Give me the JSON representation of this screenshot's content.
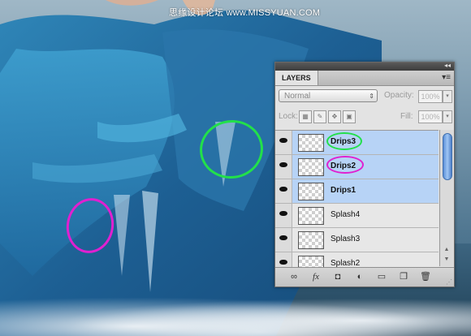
{
  "watermark": "思缘设计论坛 www.MISSYUAN.COM",
  "panel": {
    "tab": "LAYERS",
    "blend_mode": "Normal",
    "opacity_label": "Opacity:",
    "opacity_value": "100%",
    "lock_label": "Lock:",
    "fill_label": "Fill:",
    "fill_value": "100%",
    "layers": [
      {
        "name": "Drips3",
        "selected": true
      },
      {
        "name": "Drips2",
        "selected": true
      },
      {
        "name": "Drips1",
        "selected": true
      },
      {
        "name": "Splash4",
        "selected": false
      },
      {
        "name": "Splash3",
        "selected": false
      },
      {
        "name": "Splash2",
        "selected": false
      }
    ]
  },
  "colors": {
    "selection": "#b7d3f6",
    "annotation_green": "#22e04a",
    "annotation_magenta": "#e020d0"
  },
  "icons": [
    "link-icon",
    "fx-icon",
    "mask-icon",
    "adjustment-icon",
    "folder-icon",
    "new-layer-icon",
    "trash-icon"
  ]
}
